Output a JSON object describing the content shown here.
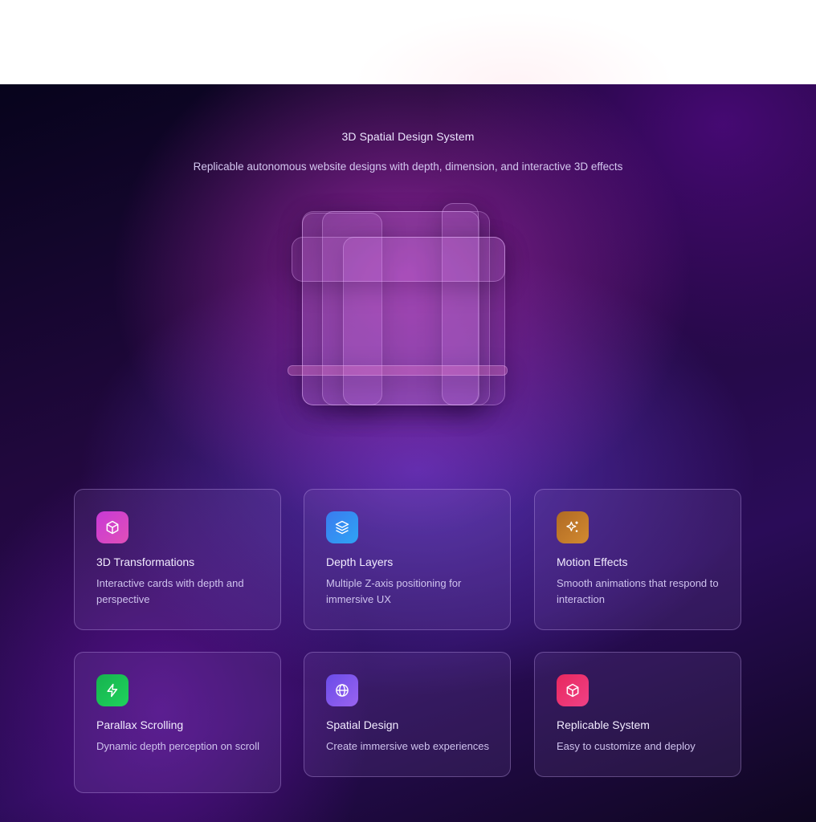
{
  "header": {
    "title": "3D Spatial Design System",
    "subtitle": "Replicable autonomous website designs with depth, dimension, and interactive 3D effects"
  },
  "colors": {
    "card_1_icon": [
      "#c839d6",
      "#e04fb8"
    ],
    "card_2_icon": [
      "#3a7bef",
      "#2fa3f5"
    ],
    "card_3_icon": [
      "#b06a24",
      "#d28a30"
    ],
    "card_4_icon": [
      "#16b24f",
      "#1fd35c"
    ],
    "card_5_icon": [
      "#6a4ce8",
      "#9a63f0"
    ],
    "card_6_icon": [
      "#e8285e",
      "#f04186"
    ]
  },
  "features": [
    {
      "title": "3D Transformations",
      "description": "Interactive cards with depth and perspective",
      "icon": "cube-icon"
    },
    {
      "title": "Depth Layers",
      "description": "Multiple Z-axis positioning for immersive UX",
      "icon": "layers-icon"
    },
    {
      "title": "Motion Effects",
      "description": "Smooth animations that respond to interaction",
      "icon": "sparkles-icon"
    },
    {
      "title": "Parallax Scrolling",
      "description": "Dynamic depth perception on scroll",
      "icon": "lightning-icon"
    },
    {
      "title": "Spatial Design",
      "description": "Create immersive web experiences",
      "icon": "globe-icon"
    },
    {
      "title": "Replicable System",
      "description": "Easy to customize and deploy",
      "icon": "box-icon"
    }
  ]
}
